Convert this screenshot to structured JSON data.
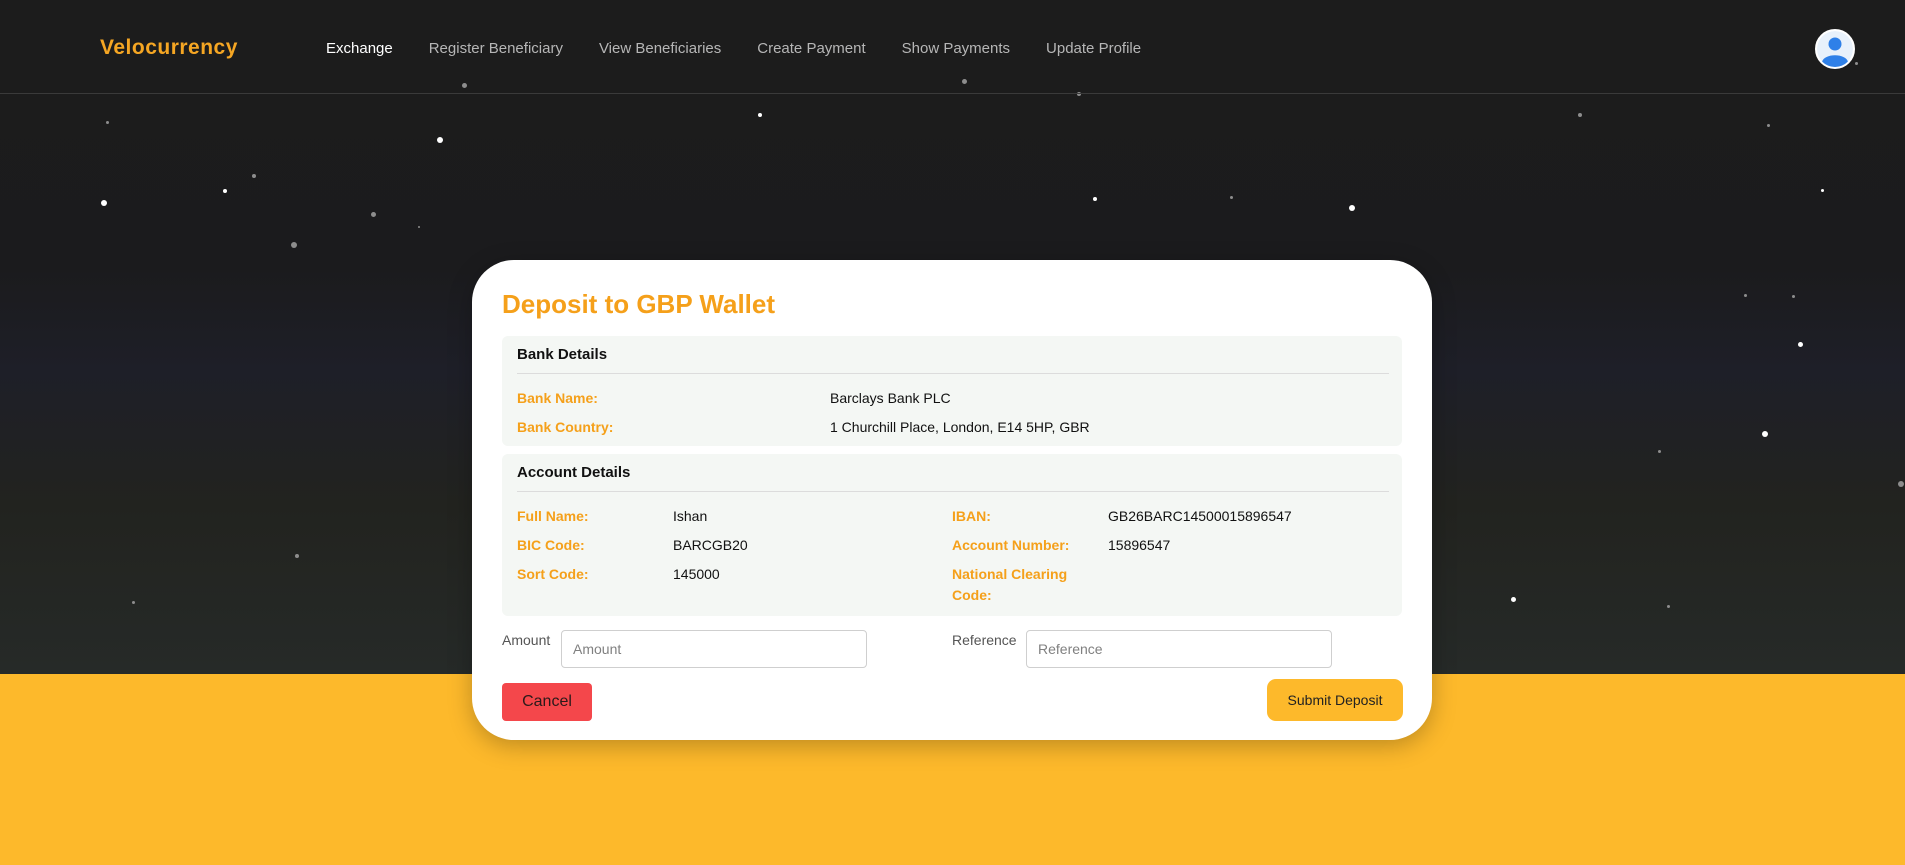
{
  "app": {
    "brand": "Velocurrency"
  },
  "nav": {
    "items": [
      {
        "label": "Exchange",
        "active": true
      },
      {
        "label": "Register Beneficiary",
        "active": false
      },
      {
        "label": "View Beneficiaries",
        "active": false
      },
      {
        "label": "Create Payment",
        "active": false
      },
      {
        "label": "Show Payments",
        "active": false
      },
      {
        "label": "Update Profile",
        "active": false
      }
    ],
    "avatar_icon": "user-avatar-icon"
  },
  "card": {
    "title": "Deposit to GBP Wallet",
    "bank_details": {
      "heading": "Bank Details",
      "bank_name_label": "Bank Name:",
      "bank_name": "Barclays Bank PLC",
      "bank_country_label": "Bank Country:",
      "bank_country": "1 Churchill Place, London, E14 5HP, GBR"
    },
    "account_details": {
      "heading": "Account Details",
      "full_name_label": "Full Name:",
      "full_name": "Ishan",
      "bic_label": "BIC Code:",
      "bic": "BARCGB20",
      "sort_code_label": "Sort Code:",
      "sort_code": "145000",
      "iban_label": "IBAN:",
      "iban": "GB26BARC14500015896547",
      "account_number_label": "Account Number:",
      "account_number": "15896547",
      "ncc_label": "National Clearing Code:",
      "ncc": ""
    },
    "form": {
      "amount_label": "Amount",
      "amount_placeholder": "Amount",
      "amount_value": "",
      "reference_label": "Reference",
      "reference_placeholder": "Reference",
      "reference_value": ""
    },
    "buttons": {
      "cancel": "Cancel",
      "submit": "Submit Deposit"
    }
  },
  "colors": {
    "accent": "#f5a01a",
    "brand": "#f5a623",
    "footer_band": "#fdb92b",
    "cancel": "#f4474b",
    "background": "#1b1b1b"
  }
}
